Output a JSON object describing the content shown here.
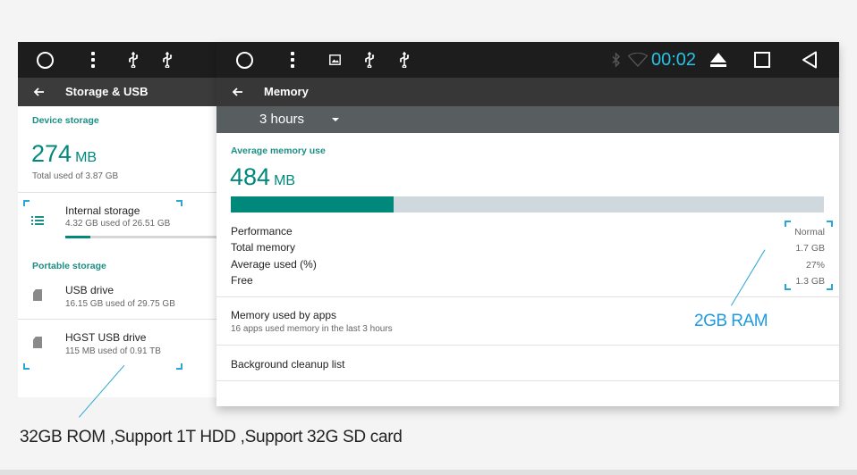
{
  "back_screen": {
    "title": "Storage & USB",
    "device_storage_label": "Device storage",
    "used_value": "274",
    "used_unit": "MB",
    "total_used_text": "Total used of 3.87 GB",
    "internal_storage": {
      "name": "Internal storage",
      "detail": "4.32 GB used of 26.51 GB",
      "used_fraction": 0.163
    },
    "portable_storage_label": "Portable storage",
    "usb_drive": {
      "name": "USB drive",
      "detail": "16.15 GB used of 29.75 GB"
    },
    "hgst_drive": {
      "name": "HGST USB drive",
      "detail": "115 MB used of 0.91 TB"
    }
  },
  "front_screen": {
    "time": "00:02",
    "title": "Memory",
    "period": "3 hours",
    "avg_memory_label": "Average memory use",
    "avg_value": "484",
    "avg_unit": "MB",
    "memory_used_fraction": 0.275,
    "stats": [
      {
        "label": "Performance",
        "value": "Normal"
      },
      {
        "label": "Total memory",
        "value": "1.7 GB"
      },
      {
        "label": "Average used (%)",
        "value": "27%"
      },
      {
        "label": "Free",
        "value": "1.3 GB"
      }
    ],
    "apps_title": "Memory used by apps",
    "apps_detail": "16 apps used memory in the last 3 hours",
    "cleanup_title": "Background cleanup list"
  },
  "annotations": {
    "ram": "2GB RAM",
    "caption": "32GB ROM ,Support 1T HDD ,Support 32G SD card"
  },
  "colors": {
    "accent": "#00897b",
    "status_bar": "#1d1d1d",
    "app_bar": "#373737",
    "clock": "#26c3e6",
    "annotation": "#2aa6d5"
  }
}
